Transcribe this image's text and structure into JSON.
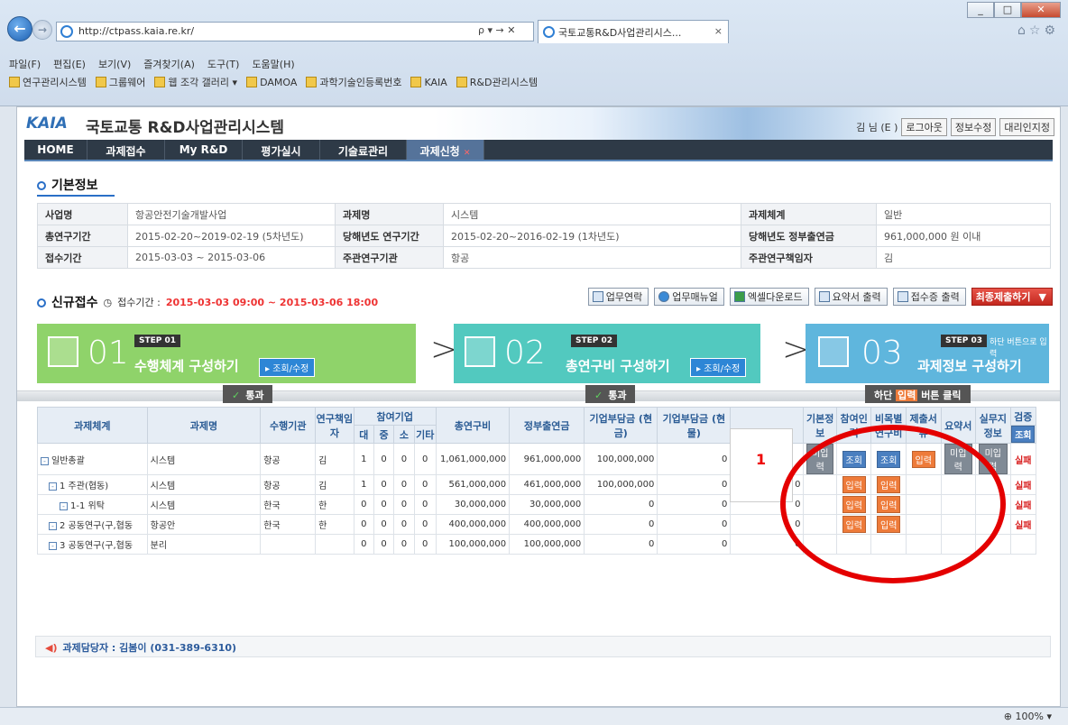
{
  "browser": {
    "url": "http://ctpass.kaia.re.kr/",
    "addr_controls": "ρ ▾ → ✕",
    "tab_title": "국토교통R&D사업관리시스...",
    "window_buttons": [
      "▭",
      "□",
      "✕"
    ],
    "menu": [
      "파일(F)",
      "편집(E)",
      "보기(V)",
      "즐겨찾기(A)",
      "도구(T)",
      "도움말(H)"
    ],
    "favorites": [
      "연구관리시스템",
      "그룹웨어",
      "웹 조각 갤러리 ▾",
      "DAMOA",
      "과학기술인등록번호",
      "KAIA",
      "R&D관리시스템"
    ],
    "zoom": "100%"
  },
  "header": {
    "logo": "KAIA",
    "system_title": "국토교통 R&D사업관리시스템",
    "user_text": "김     님 (E     )",
    "logout": "로그아웃",
    "edit_info": "정보수정",
    "delegate": "대리인지정"
  },
  "nav": [
    "HOME",
    "과제접수",
    "My R&D",
    "평가실시",
    "기술료관리",
    "과제신청"
  ],
  "basic_info": {
    "title": "기본정보",
    "rows": [
      [
        "사업명",
        "항공안전기술개발사업",
        "과제명",
        "시스템",
        "과제체계",
        "일반"
      ],
      [
        "총연구기간",
        "2015-02-20~2019-02-19 (5차년도)",
        "당해년도 연구기간",
        "2015-02-20~2016-02-19 (1차년도)",
        "당해년도 정부출연금",
        "961,000,000 원 이내"
      ],
      [
        "접수기간",
        "2015-03-03 ~ 2015-03-06",
        "주관연구기관",
        "항공",
        "주관연구책임자",
        "김"
      ]
    ]
  },
  "new_receipt": {
    "title": "신규접수",
    "period_label": "접수기간 :",
    "period": "2015-03-03 09:00 ~ 2015-03-06 18:00",
    "actions": [
      "업무연락",
      "업무매뉴얼",
      "엑셀다운로드",
      "요약서 출력",
      "접수증 출력"
    ],
    "final_submit": "최종제출하기"
  },
  "steps": [
    {
      "badge": "STEP 01",
      "num": "01",
      "title": "수행체계 구성하기",
      "btn": "조회/수정",
      "status": "통과"
    },
    {
      "badge": "STEP 02",
      "num": "02",
      "title": "총연구비 구성하기",
      "btn": "조회/수정",
      "status": "통과"
    },
    {
      "badge": "STEP 03",
      "num": "03",
      "title": "과제정보 구성하기",
      "hint": "하단 버튼으로 입력",
      "status_pre": "하단",
      "status_hl": "입력",
      "status_post": "버튼 클릭"
    }
  ],
  "grid": {
    "headers": [
      "과제체계",
      "과제명",
      "수행기관",
      "연구책임자",
      "참여기업",
      "총연구비",
      "정부출연금",
      "기업부담금 (현금)",
      "기업부담금 (현물)",
      "",
      "기본정보",
      "참여인력",
      "비목별 연구비",
      "제출서류",
      "요약서",
      "실무지 정보",
      "검증"
    ],
    "sub_headers": [
      "대",
      "중",
      "소",
      "기타"
    ],
    "verify_btn": "조회",
    "rows": [
      {
        "sys": "일반총괄",
        "name": "시스템",
        "org": "항공",
        "pi": "김",
        "c": [
          "1",
          "0",
          "0",
          "0"
        ],
        "total": "1,061,000,000",
        "gov": "961,000,000",
        "cash": "100,000,000",
        "kind": "0",
        "z": "",
        "b": [
          "미입력",
          "조회",
          "조회",
          "입력",
          "미입력",
          "미입력"
        ],
        "verify": "실패"
      },
      {
        "sys": "1 주관(협동)",
        "name": "시스템",
        "org": "항공",
        "pi": "김",
        "c": [
          "1",
          "0",
          "0",
          "0"
        ],
        "total": "561,000,000",
        "gov": "461,000,000",
        "cash": "100,000,000",
        "kind": "0",
        "z": "0",
        "b": [
          "",
          "입력",
          "입력",
          "",
          "",
          ""
        ],
        "verify": "실패"
      },
      {
        "sys": "1-1 위탁",
        "name": "시스템",
        "org": "한국",
        "pi": "한",
        "c": [
          "0",
          "0",
          "0",
          "0"
        ],
        "total": "30,000,000",
        "gov": "30,000,000",
        "cash": "0",
        "kind": "0",
        "z": "0",
        "b": [
          "",
          "입력",
          "입력",
          "",
          "",
          ""
        ],
        "verify": "실패"
      },
      {
        "sys": "2 공동연구(구,협동",
        "name": "항공안",
        "org": "한국",
        "pi": "한",
        "c": [
          "0",
          "0",
          "0",
          "0"
        ],
        "total": "400,000,000",
        "gov": "400,000,000",
        "cash": "0",
        "kind": "0",
        "z": "0",
        "b": [
          "",
          "입력",
          "입력",
          "",
          "",
          ""
        ],
        "verify": "실패"
      },
      {
        "sys": "3 공동연구(구,협동",
        "name": "분리",
        "org": "",
        "pi": "",
        "c": [
          "0",
          "0",
          "0",
          "0"
        ],
        "total": "100,000,000",
        "gov": "100,000,000",
        "cash": "0",
        "kind": "0",
        "z": "0",
        "b": [
          "",
          "",
          "",
          "",
          "",
          ""
        ],
        "verify": ""
      }
    ]
  },
  "callout_number": "1",
  "contact": "과제담당자 : 김봄이 (031-389-6310)"
}
